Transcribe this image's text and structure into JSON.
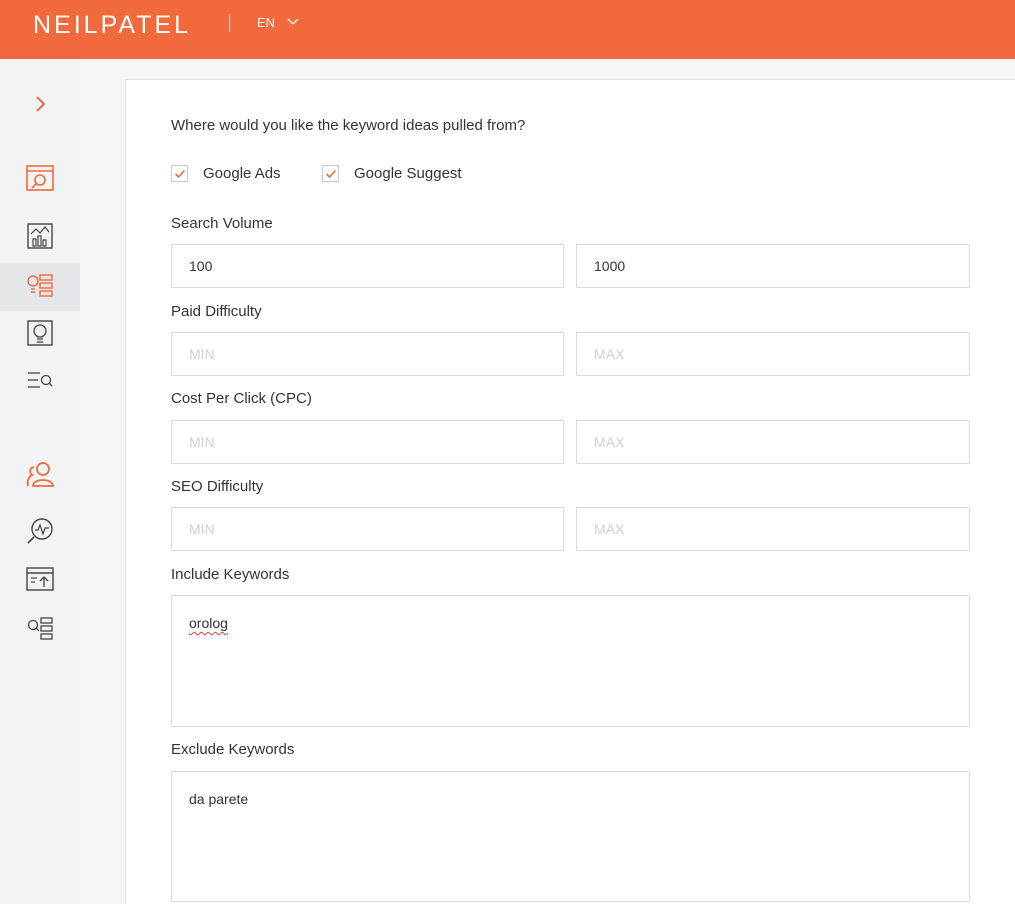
{
  "header": {
    "logo": "NEILPATEL",
    "language": "EN",
    "brand_color": "#f26a3b"
  },
  "sidebar": {
    "items": [
      {
        "icon": "chevron-right-icon"
      },
      {
        "icon": "site-audit-icon"
      },
      {
        "icon": "traffic-analyzer-icon"
      },
      {
        "icon": "keyword-ideas-icon",
        "active": true
      },
      {
        "icon": "content-ideas-icon"
      },
      {
        "icon": "keyword-search-icon"
      },
      {
        "icon": "users-icon"
      },
      {
        "icon": "rank-tracker-icon"
      },
      {
        "icon": "backlinks-icon"
      },
      {
        "icon": "list-search-icon"
      }
    ]
  },
  "form": {
    "question": "Where would you like the keyword ideas pulled from?",
    "sources": [
      {
        "label": "Google Ads",
        "checked": true
      },
      {
        "label": "Google Suggest",
        "checked": true
      }
    ],
    "search_volume": {
      "label": "Search Volume",
      "min_value": "100",
      "max_value": "1000"
    },
    "paid_difficulty": {
      "label": "Paid Difficulty",
      "min_placeholder": "MIN",
      "max_placeholder": "MAX"
    },
    "cpc": {
      "label": "Cost Per Click (CPC)",
      "min_placeholder": "MIN",
      "max_placeholder": "MAX"
    },
    "seo_difficulty": {
      "label": "SEO Difficulty",
      "min_placeholder": "MIN",
      "max_placeholder": "MAX"
    },
    "include": {
      "label": "Include Keywords",
      "value": "orolog"
    },
    "exclude": {
      "label": "Exclude Keywords",
      "value": "da parete"
    }
  }
}
